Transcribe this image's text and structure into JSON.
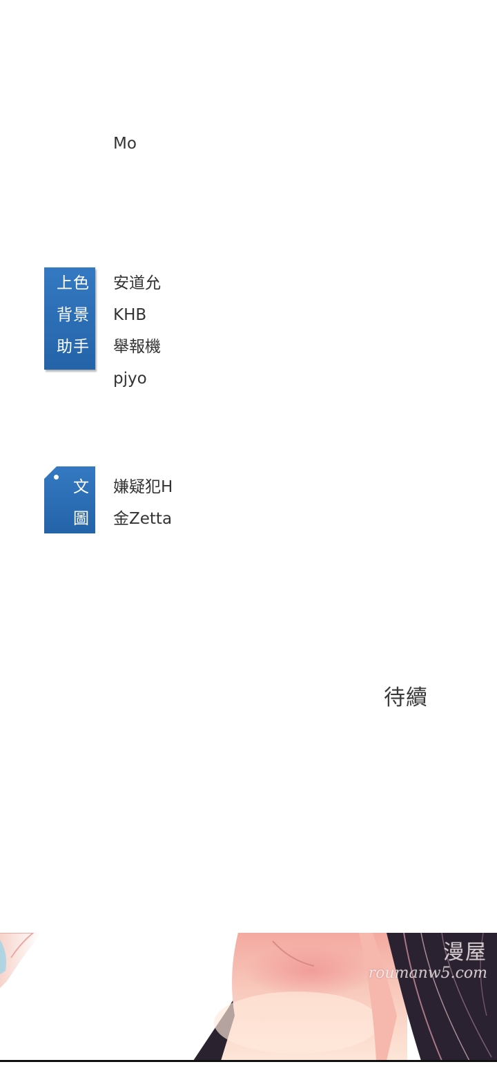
{
  "credits": {
    "top_name": "Mo",
    "color_tag": {
      "lines": [
        "上色",
        "背景",
        "助手"
      ]
    },
    "color_names": [
      "安道允",
      "KHB",
      "舉報機",
      "pjyo"
    ],
    "script_tag": {
      "lines": [
        "文",
        "圖"
      ]
    },
    "script_names": [
      "嫌疑犯H",
      "金Zetta"
    ]
  },
  "ending": {
    "to_be_continued": "待續"
  },
  "watermark": {
    "site_name": "漫屋",
    "url": "roumanw5.com"
  },
  "colors": {
    "tag_blue": "#2c6fb6",
    "text_dark": "#333333",
    "skin": "#f6c6b8",
    "hair": "#2a2230"
  },
  "icons": {
    "tag_hole": "circle-dot-icon"
  }
}
